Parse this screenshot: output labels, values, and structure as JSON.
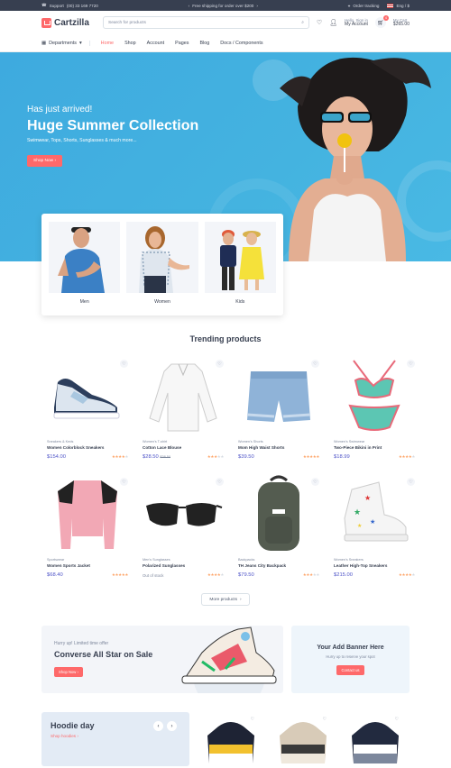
{
  "topbar": {
    "support": "Support",
    "phone": "(00) 33 169 7720",
    "shipping": "Free shipping for order over $200",
    "tracking": "Order tracking",
    "lang": "Eng / $"
  },
  "header": {
    "brand": "Cartzilla",
    "search_placeholder": "Search for products",
    "account_line1": "Hello, Sign in",
    "account_line2": "My Account",
    "cart_label": "My Cart",
    "cart_total": "$265.00",
    "cart_count": "4"
  },
  "nav": {
    "departments": "Departments",
    "items": [
      "Home",
      "Shop",
      "Account",
      "Pages",
      "Blog",
      "Docs / Components"
    ],
    "active": "Home"
  },
  "hero": {
    "kicker": "Has just arrived!",
    "title": "Huge Summer Collection",
    "subtitle": "Swimwear, Tops, Shorts, Sunglasses & much more...",
    "button": "Shop Now"
  },
  "categories": [
    {
      "label": "Men"
    },
    {
      "label": "Women"
    },
    {
      "label": "Kids"
    }
  ],
  "trending": {
    "title": "Trending products",
    "more": "More products"
  },
  "products": [
    {
      "category": "Sneakers & Keds",
      "name": "Women Colorblock Sneakers",
      "price": "$154.00",
      "old": "",
      "rating": 4
    },
    {
      "category": "Women's T-shirt",
      "name": "Cotton Lace Blouse",
      "price": "$28.50",
      "old": "$38.50",
      "rating": 3
    },
    {
      "category": "Women's Shorts",
      "name": "Mom High Waist Shorts",
      "price": "$39.50",
      "old": "",
      "rating": 5
    },
    {
      "category": "Women's Swimwear",
      "name": "Two-Piece Bikini in Print",
      "price": "$18.99",
      "old": "",
      "rating": 4
    },
    {
      "category": "Sportswear",
      "name": "Women Sports Jacket",
      "price": "$68.40",
      "old": "",
      "rating": 5
    },
    {
      "category": "Men's Sunglasses",
      "name": "Polarized Sunglasses",
      "price": "",
      "old": "",
      "stock": "Out of stock",
      "rating": 4
    },
    {
      "category": "Backpacks",
      "name": "TH Jeans City Backpack",
      "price": "$79.50",
      "old": "",
      "rating": 3
    },
    {
      "category": "Women's Sneakers",
      "name": "Leather High-Top Sneakers",
      "price": "$215.00",
      "old": "",
      "rating": 4
    }
  ],
  "promo": {
    "kicker": "Hurry up! Limited time offer",
    "title": "Converse All Star on Sale",
    "button": "Shop Now"
  },
  "banner": {
    "title": "Your Add Banner Here",
    "text": "Hurry up to reserve your spot",
    "button": "Contact us"
  },
  "hoodie": {
    "title": "Hoodie day",
    "link": "Shop hoodies"
  },
  "colors": {
    "accent": "#fe696a",
    "dark": "#373f50",
    "price": "#4e54c8",
    "hero": "#44b3e0"
  }
}
